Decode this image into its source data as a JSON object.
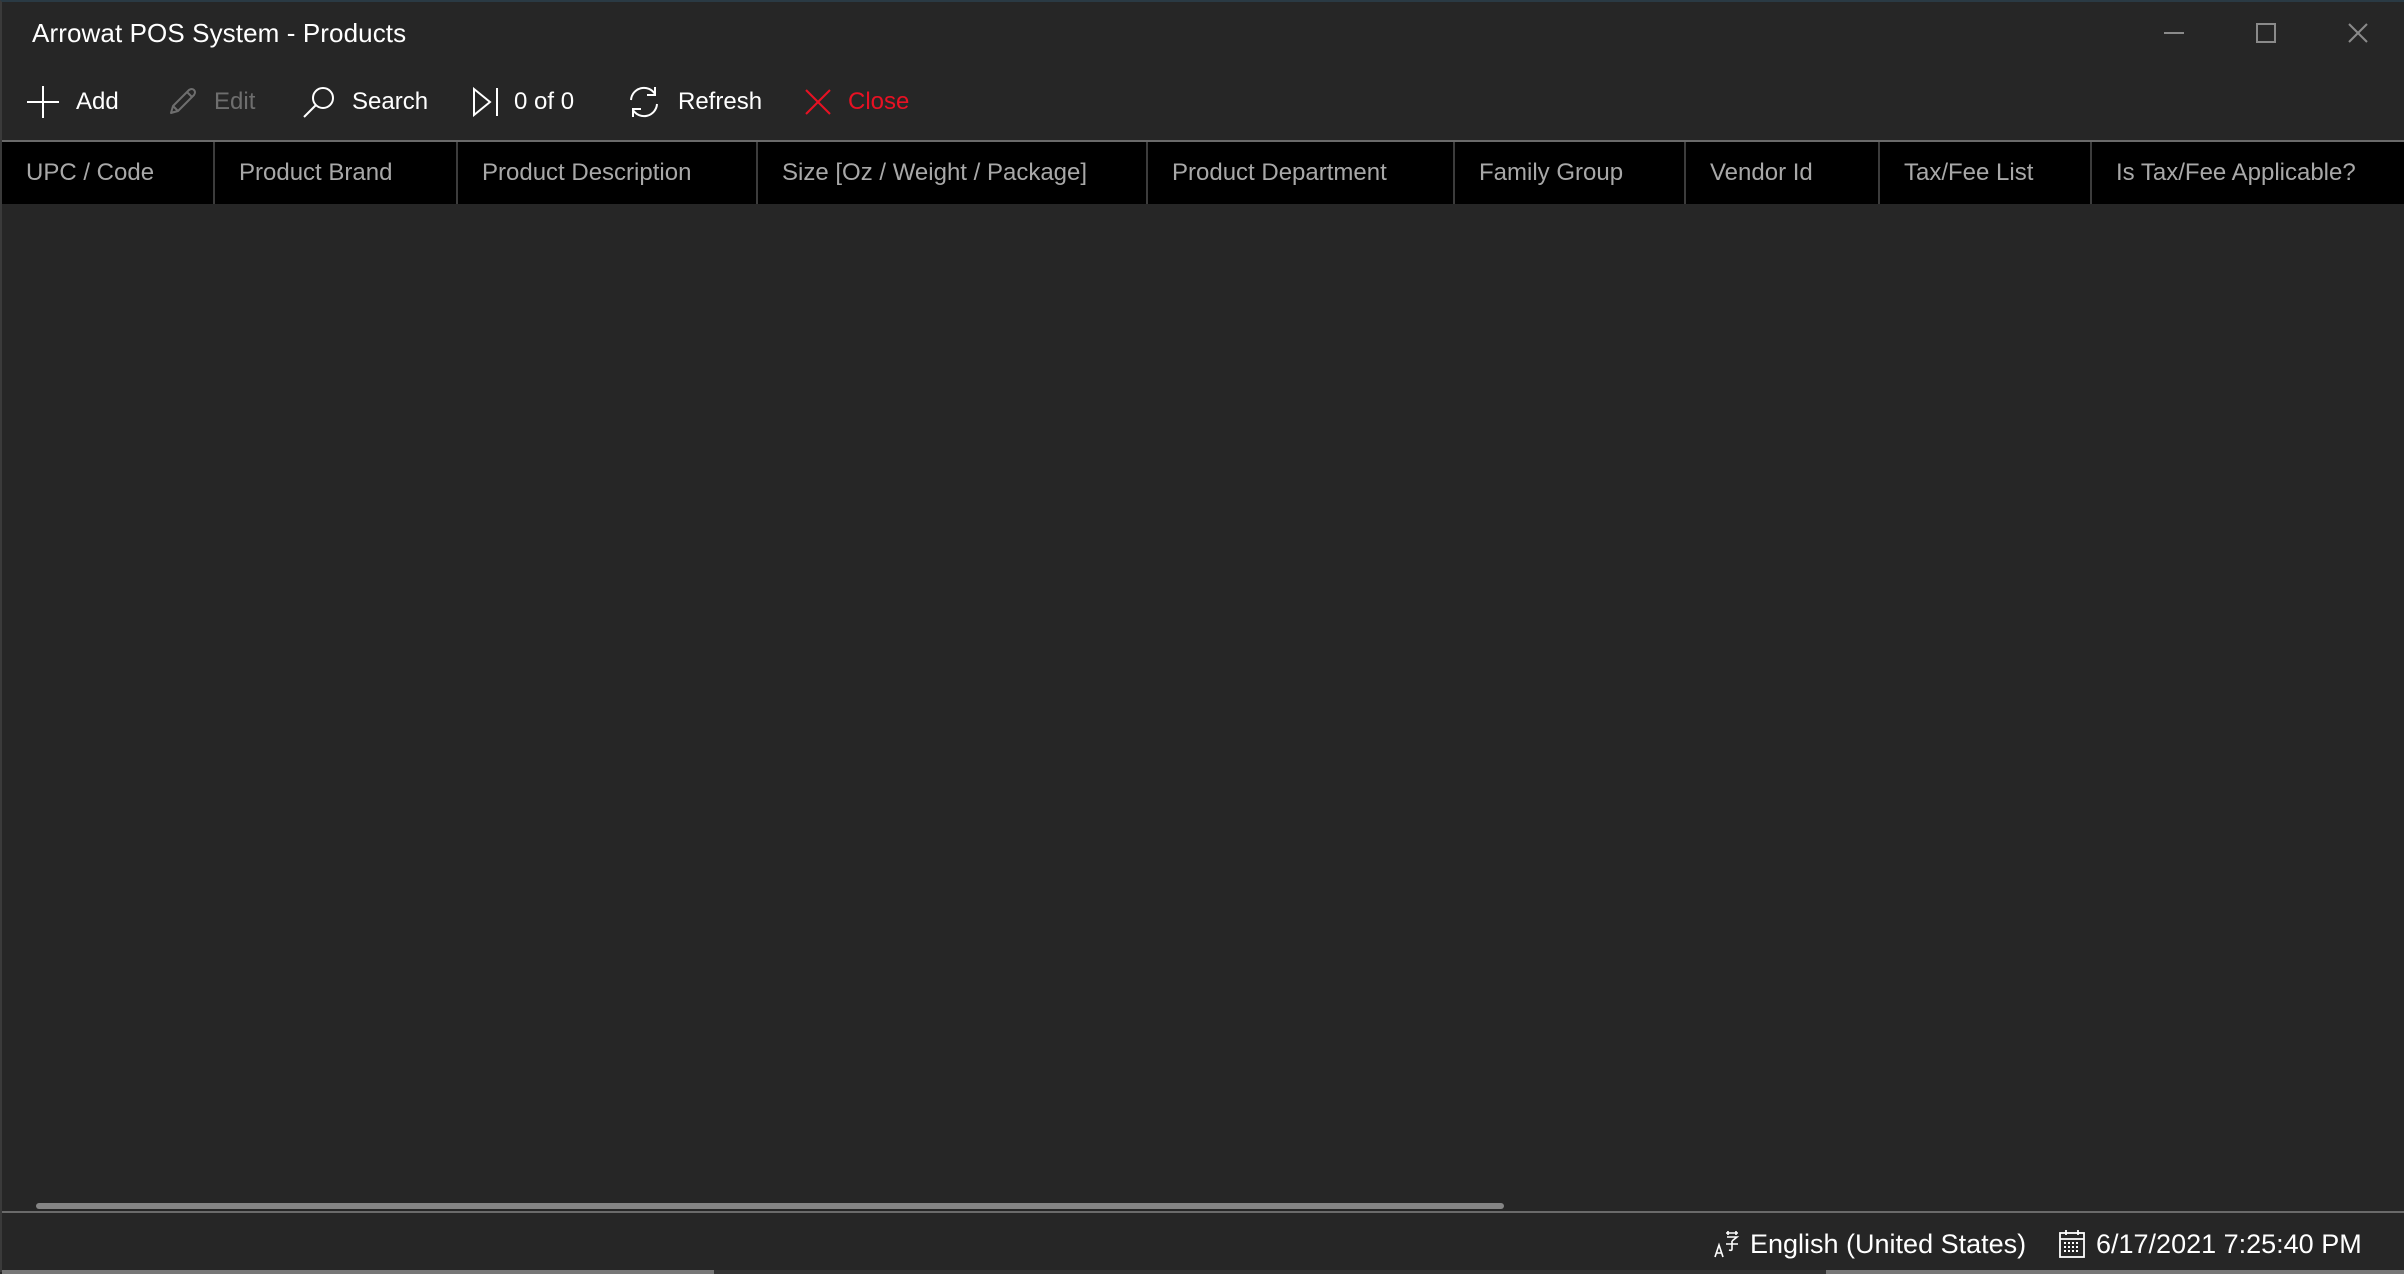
{
  "window": {
    "title": "Arrowat POS System - Products",
    "controls": {
      "minimize": "minimize",
      "maximize": "maximize",
      "close": "close"
    }
  },
  "toolbar": {
    "add": {
      "label": "Add",
      "icon": "plus-icon",
      "enabled": true
    },
    "edit": {
      "label": "Edit",
      "icon": "pencil-icon",
      "enabled": false
    },
    "search": {
      "label": "Search",
      "icon": "search-icon",
      "enabled": true
    },
    "navigation": {
      "label": "0 of 0",
      "icon": "skip-to-end-icon",
      "current": 0,
      "total": 0
    },
    "refresh": {
      "label": "Refresh",
      "icon": "refresh-icon",
      "enabled": true
    },
    "close": {
      "label": "Close",
      "icon": "close-x-icon",
      "enabled": true,
      "color": "#e81123"
    }
  },
  "grid": {
    "columns": [
      {
        "label": "UPC / Code"
      },
      {
        "label": "Product Brand"
      },
      {
        "label": "Product Description"
      },
      {
        "label": "Size [Oz / Weight / Package]"
      },
      {
        "label": "Product Department"
      },
      {
        "label": "Family Group"
      },
      {
        "label": "Vendor Id"
      },
      {
        "label": "Tax/Fee List"
      },
      {
        "label": "Is Tax/Fee Applicable?"
      }
    ],
    "rows": []
  },
  "statusbar": {
    "language": {
      "label": "English (United States)",
      "icon": "language-icon"
    },
    "clock": {
      "label": "6/17/2021 7:25:40 PM",
      "icon": "calendar-icon"
    }
  },
  "colors": {
    "background": "#262626",
    "header_background": "#000000",
    "header_text": "#a8a8a8",
    "danger": "#e81123",
    "disabled": "#6e6e6e"
  }
}
